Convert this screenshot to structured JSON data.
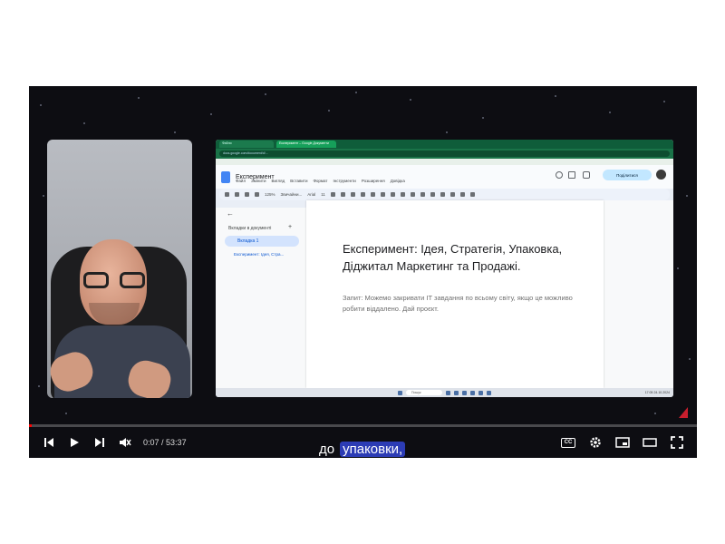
{
  "browser": {
    "tabs": [
      "Файли",
      "Експеримент – Google Документи"
    ],
    "url": "docs.google.com/document/d/..."
  },
  "docs": {
    "title": "Експеримент",
    "menu": [
      "Файл",
      "Змінити",
      "Вигляд",
      "Вставити",
      "Формат",
      "Інструменти",
      "Розширення",
      "Довідка"
    ],
    "share_label": "Поділитися",
    "toolbar": {
      "zoom": "125%",
      "style": "Звичайни...",
      "font": "Arial",
      "size": "11"
    },
    "sidebar": {
      "title": "Вкладки в документі",
      "tab_label": "Вкладка 1",
      "outline_item": "Експеримент: Ідея, Стра..."
    },
    "heading": "Експеримент: Ідея, Стратегія, Упаковка, Діджитал Маркетинг та Продажі.",
    "subtext": "Запит: Можемо закривати IT завдання по всьому світу, якщо це можливо робити віддалено. Дай проєкт."
  },
  "taskbar": {
    "search_label": "Пошук",
    "time": "17:05",
    "date": "24.10.2024"
  },
  "player": {
    "time_current": "0:07",
    "time_total": "53:37",
    "progress_fraction": 0.002,
    "caption_word1": "до",
    "caption_word2": "упаковки,",
    "cc_label": "CC",
    "icons": [
      "skip-back-icon",
      "play-icon",
      "skip-next-icon",
      "mute-icon",
      "cc-icon",
      "settings-icon",
      "miniplayer-icon",
      "theater-icon",
      "fullscreen-icon"
    ],
    "colors": {
      "progress": "#ff0000",
      "caption_highlight": "#2c3cb5",
      "marker": "#c81e2d"
    }
  }
}
